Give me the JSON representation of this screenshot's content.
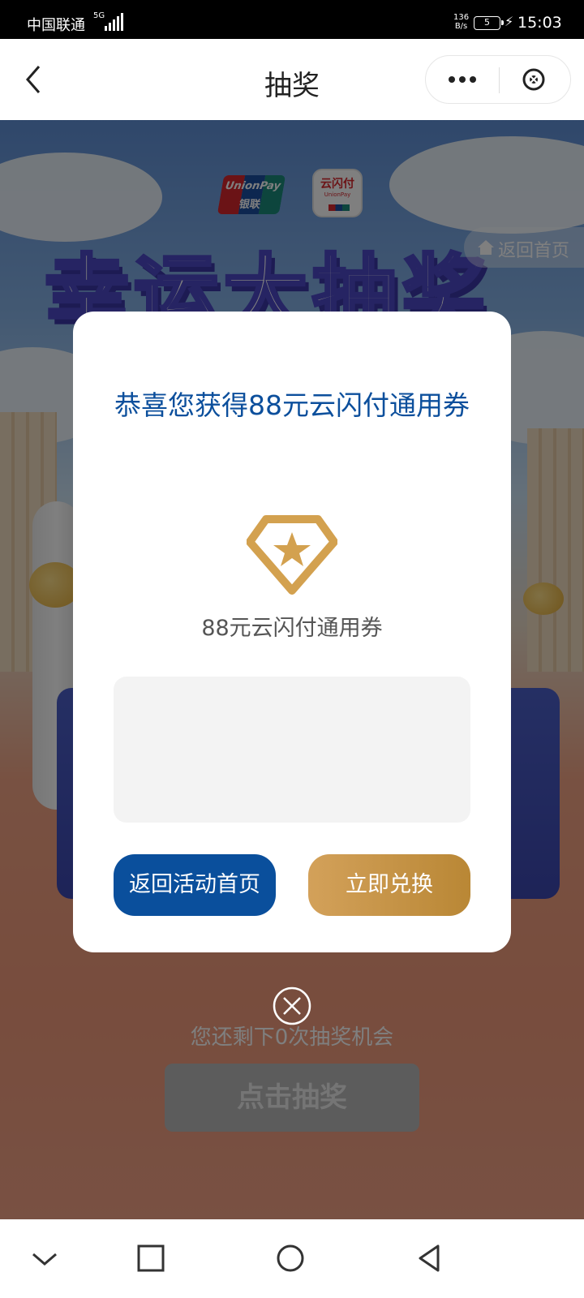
{
  "status_bar": {
    "carrier": "中国联通",
    "network_type": "5G",
    "net_speed_value": "136",
    "net_speed_unit": "B/s",
    "battery_level": "5",
    "time": "15:03"
  },
  "nav_bar": {
    "title": "抽奖"
  },
  "background": {
    "logo_unionpay_line1": "UnionPay",
    "logo_unionpay_line2": "银联",
    "logo_ysf_line1": "云闪付",
    "logo_ysf_line2": "UnionPay",
    "headline": "幸运大抽奖",
    "home_link": "返回首页",
    "remaining_text": "您还剩下0次抽奖机会",
    "draw_button": "点击抽奖"
  },
  "modal": {
    "title": "恭喜您获得88元云闪付通用券",
    "prize_name": "88元云闪付通用券",
    "back_button": "返回活动首页",
    "redeem_button": "立即兑换"
  },
  "colors": {
    "brand_blue": "#0a4f9c",
    "gold": "#c9953e",
    "title_blue": "#0c4f9c"
  }
}
